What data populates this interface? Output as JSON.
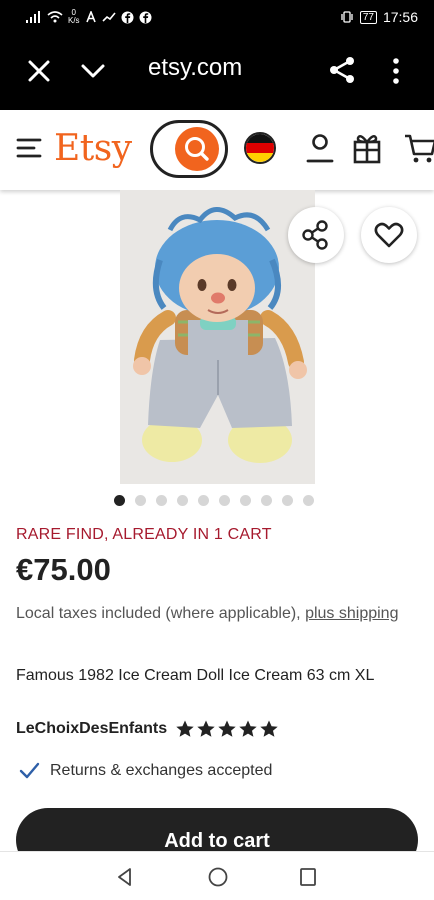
{
  "status_bar": {
    "speed_value": "0",
    "speed_unit": "K/s",
    "battery": "77",
    "time": "17:56"
  },
  "browser": {
    "url": "etsy.com"
  },
  "header": {
    "logo": "Etsy",
    "brand_color": "#f1641e"
  },
  "listing": {
    "image_count": 10,
    "active_image": 1,
    "rare_label": "RARE FIND, ALREADY IN 1 CART",
    "price": "€75.00",
    "taxes_text": "Local taxes included (where applicable), ",
    "taxes_link": "plus shipping",
    "title": "Famous 1982 Ice Cream Doll Ice Cream 63 cm XL",
    "shop_name": "LeChoixDesEnfants",
    "rating": 5,
    "returns": "Returns & exchanges accepted",
    "add_to_cart": "Add to cart"
  },
  "icons": {
    "close": "close-icon",
    "chevron": "chevron-down-icon",
    "share": "share-icon",
    "more": "more-vertical-icon",
    "menu": "hamburger-menu-icon",
    "search": "search-icon",
    "flag": "germany-flag-icon",
    "user": "user-icon",
    "gift": "gift-icon",
    "cart": "cart-icon",
    "favorite": "heart-icon",
    "check": "check-icon",
    "star": "star-icon"
  }
}
